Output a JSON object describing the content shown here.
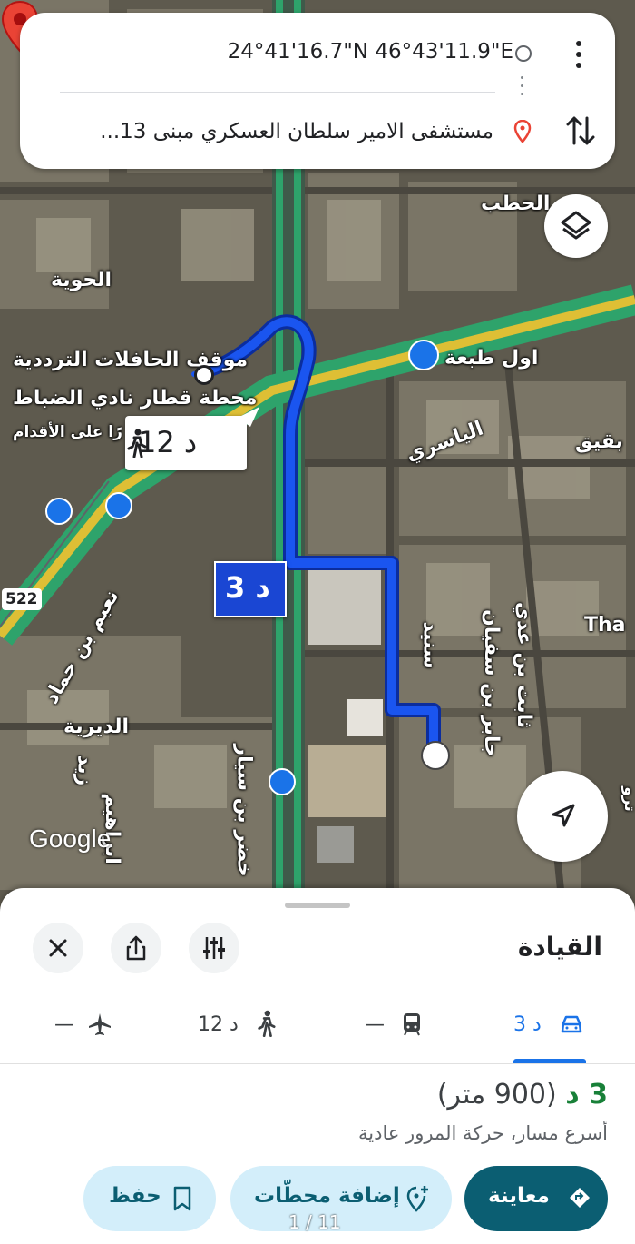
{
  "search": {
    "origin": "24°41'16.7\"N 46°43'11.9\"E",
    "destination": "مستشفى الامير سلطان العسكري مبنى 13..."
  },
  "map": {
    "labels": {
      "hawiya": "الحوية",
      "bus_stop": "موقف الحافلات الترددية",
      "train_station": "محطة قطار نادي الضباط",
      "walkway": "رًا على الأقدام",
      "hatab": "الحطب",
      "taba": "اول طبعة",
      "yasiri": "الياسري",
      "baqiq": "بقيق",
      "sanid": "سنيد",
      "jabir": "جابر بن سفيان",
      "thabit": "ثابت بن عدي",
      "tha": "Tha",
      "naeem": "نعيم بن حماد",
      "diriya": "الديرية",
      "zaid": "زيد",
      "ibrahim": "ابراهيم",
      "khadir": "خضر بن سيار",
      "road_522": "522",
      "tru": "ترو"
    },
    "google_logo": "Google",
    "walk_callout": "12 د",
    "drive_callout": "3 د"
  },
  "sheet": {
    "title": "القيادة",
    "modes": {
      "drive": "3 د",
      "transit": "—",
      "walk": "12 د",
      "flight": "—"
    },
    "time": "3 د",
    "distance": "(900 متر)",
    "description": "أسرع مسار، حركة المرور عادية",
    "buttons": {
      "preview": "معاينة",
      "add_stops": "إضافة محطّات",
      "save": "حفظ"
    },
    "page_indicator": "1 / 11"
  },
  "colors": {
    "route": "#1a46d3",
    "accent": "#1a73e8",
    "green": "#188038",
    "pin": "#ea4335"
  }
}
